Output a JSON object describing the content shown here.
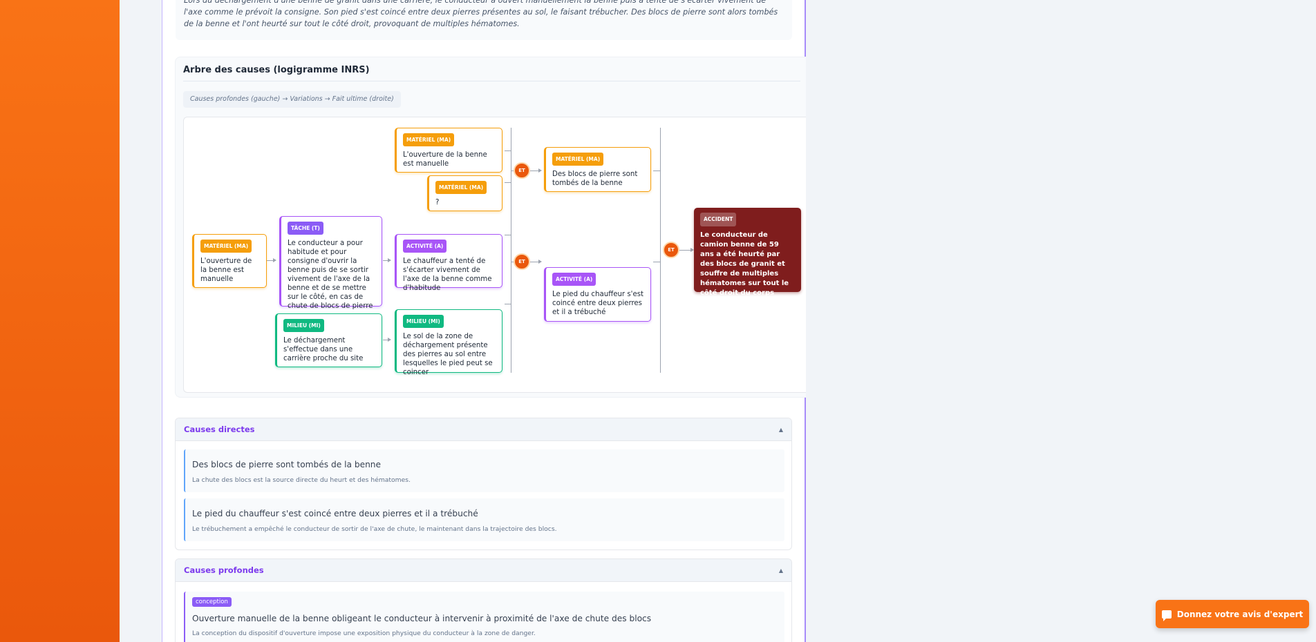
{
  "incident": {
    "description": "Lors du déchargement d'une benne de granit dans une carrière, le conducteur a ouvert manuellement la benne puis a tenté de s'écarter vivement de l'axe comme le prévoit la consigne. Son pied s'est coincé entre deux pierres présentes au sol, le faisant trébucher. Des blocs de pierre sont alors tombés de la benne et l'ont heurté sur tout le côté droit, provoquant de multiples hématomes."
  },
  "tree": {
    "title": "Arbre des causes (logigramme INRS)",
    "legend": "Causes profondes (gauche) → Variations → Fait ultime (droite)",
    "and_label": "ET",
    "nodes": {
      "ma_ouverture_top": {
        "tag": "MATÉRIEL (MA)",
        "text": "L'ouverture de la benne est manuelle"
      },
      "ma_unknown": {
        "tag": "MATÉRIEL (MA)",
        "text": "?"
      },
      "ma_blocs": {
        "tag": "MATÉRIEL (MA)",
        "text": "Des blocs de pierre sont tombés de la benne"
      },
      "ma_ouverture_left": {
        "tag": "MATÉRIEL (MA)",
        "text": "L'ouverture de la benne est manuelle"
      },
      "task_habitude": {
        "tag": "TÂCHE (T)",
        "text": "Le conducteur a pour habitude et pour consigne d'ouvrir la benne puis de se sortir vivement de l'axe de la benne et de se mettre sur le côté, en cas de chute de blocs de pierre"
      },
      "act_ecarter": {
        "tag": "ACTIVITÉ (A)",
        "text": "Le chauffeur a tenté de s'écarter vivement de l'axe de la benne comme d'habitude"
      },
      "act_pied": {
        "tag": "ACTIVITÉ (A)",
        "text": "Le pied du chauffeur s'est coincé entre deux pierres et il a trébuché"
      },
      "mi_dechargement": {
        "tag": "MILIEU (MI)",
        "text": "Le déchargement s'effectue dans une carrière proche du site"
      },
      "mi_sol": {
        "tag": "MILIEU (MI)",
        "text": "Le sol de la zone de déchargement présente des pierres au sol entre lesquelles le pied peut se coincer"
      },
      "accident": {
        "tag": "ACCIDENT",
        "text": "Le conducteur de camion benne de 59 ans a été heurté par des blocs de granit et souffre de multiples hématomes sur tout le côté droit du corps"
      }
    }
  },
  "direct_causes": {
    "title": "Causes directes",
    "caret": "▲",
    "items": [
      {
        "title": "Des blocs de pierre sont tombés de la benne",
        "desc": "La chute des blocs est la source directe du heurt et des hématomes."
      },
      {
        "title": "Le pied du chauffeur s'est coincé entre deux pierres et il a trébuché",
        "desc": "Le trébuchement a empêché le conducteur de sortir de l'axe de chute, le maintenant dans la trajectoire des blocs."
      }
    ]
  },
  "deep_causes": {
    "title": "Causes profondes",
    "caret": "▲",
    "items": [
      {
        "badge": "conception",
        "title": "Ouverture manuelle de la benne obligeant le conducteur à intervenir à proximité de l'axe de chute des blocs",
        "desc": "La conception du dispositif d'ouverture impose une exposition physique du conducteur à la zone de danger."
      }
    ]
  },
  "feedback_button": {
    "label": "Donnez votre avis d'expert",
    "icon": "chat-bubble-icon"
  },
  "colors": {
    "orange": "#f97316",
    "purple": "#7c3aed",
    "materiel": "#f59e0b",
    "activite": "#a855f7",
    "milieu": "#10b981",
    "accident": "#7f1d1d"
  }
}
